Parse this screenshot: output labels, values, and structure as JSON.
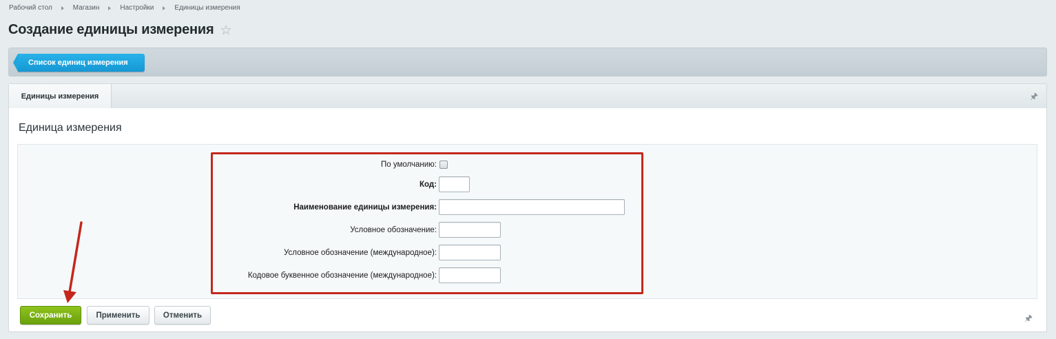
{
  "breadcrumb": [
    "Рабочий стол",
    "Магазин",
    "Настройки",
    "Единицы измерения"
  ],
  "page_title": "Создание единицы измерения",
  "toolbar": {
    "back_label": "Список единиц измерения"
  },
  "tabs": [
    {
      "label": "Единицы измерения",
      "active": true
    }
  ],
  "section_title": "Единица измерения",
  "form": {
    "default_label": "По умолчанию:",
    "code_label": "Код:",
    "code_value": "",
    "name_label": "Наименование единицы измерения:",
    "name_value": "",
    "symbol_label": "Условное обозначение:",
    "symbol_value": "",
    "symbol_intl_label": "Условное обозначение (международное):",
    "symbol_intl_value": "",
    "letter_code_intl_label": "Кодовое буквенное обозначение (международное):",
    "letter_code_intl_value": ""
  },
  "buttons": {
    "save": "Сохранить",
    "apply": "Применить",
    "cancel": "Отменить"
  },
  "colors": {
    "accent_blue": "#1fa6df",
    "save_green": "#7cb316",
    "annotation_red": "#c4271d"
  },
  "icons": [
    "star-icon",
    "pin-icon"
  ]
}
